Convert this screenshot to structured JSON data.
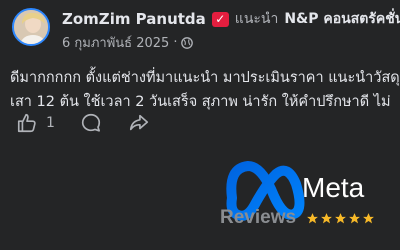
{
  "post": {
    "author": "ZomZim Panutda",
    "recommend_text": "แนะนำ",
    "page_name": "N&P คอนสตรัคชั่น",
    "date": "6 กุมภาพันธ์ 2025",
    "body_lines": [
      "ดีมากกกกก ตั้งแต่ช่างที่มาแนะนำ มาประเมินราคา แนะนำวัสดุ",
      "เสา 12 ต้น ใช้เวลา 2 วันเสร็จ สุภาพ น่ารัก ให้คำปรึกษาดี ไม่"
    ],
    "like_count": "1"
  },
  "branding": {
    "meta_text": "Meta",
    "reviews_text": "Reviews",
    "star_color": "#f7b928",
    "rating": 5
  }
}
